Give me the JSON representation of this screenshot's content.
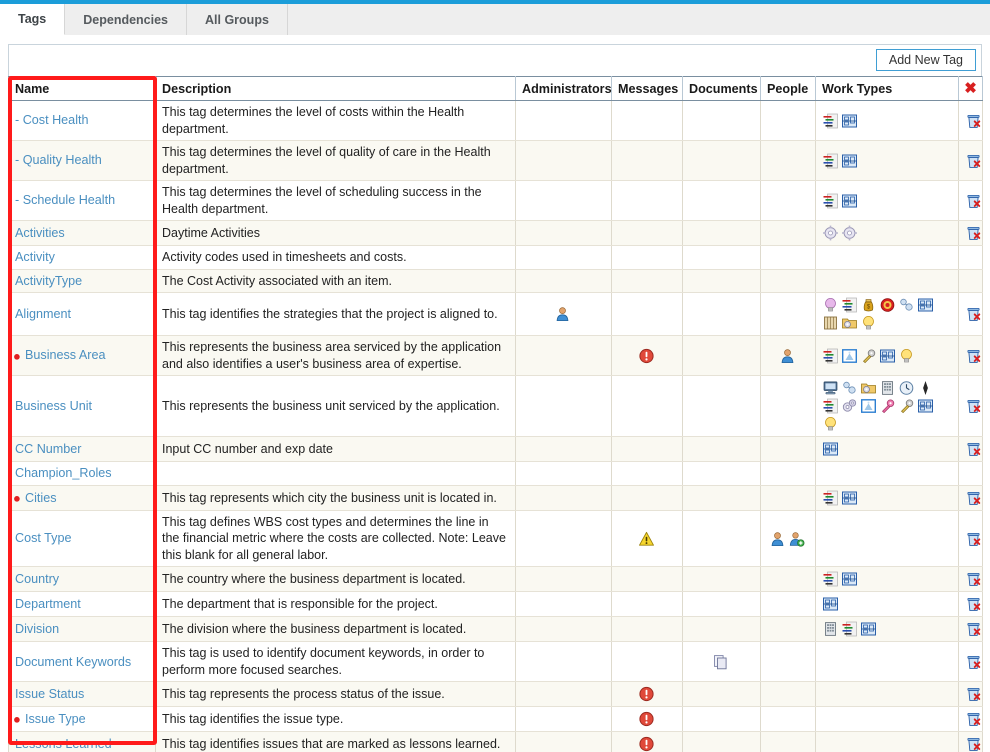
{
  "tabs": [
    {
      "label": "Tags",
      "active": true
    },
    {
      "label": "Dependencies",
      "active": false
    },
    {
      "label": "All Groups",
      "active": false
    }
  ],
  "toolbar": {
    "add_label": "Add New Tag"
  },
  "table": {
    "headers": {
      "name": "Name",
      "description": "Description",
      "administrators": "Administrators",
      "messages": "Messages",
      "documents": "Documents",
      "people": "People",
      "work_types": "Work Types",
      "delete": "delete-all-icon"
    },
    "rows": [
      {
        "name": "- Cost Health",
        "bullet": false,
        "description": "This tag determines the level of costs within the Health department.",
        "administrators": [],
        "messages": [],
        "documents": [],
        "people": [],
        "work_types": [
          "gantt-list-icon",
          "blueprint-icon"
        ],
        "delete": true
      },
      {
        "name": "- Quality Health",
        "bullet": false,
        "description": "This tag determines the level of quality of care in the Health department.",
        "administrators": [],
        "messages": [],
        "documents": [],
        "people": [],
        "work_types": [
          "gantt-list-icon",
          "blueprint-icon"
        ],
        "delete": true
      },
      {
        "name": "- Schedule Health",
        "bullet": false,
        "description": "This tag determines the level of scheduling success in the Health department.",
        "administrators": [],
        "messages": [],
        "documents": [],
        "people": [],
        "work_types": [
          "gantt-list-icon",
          "blueprint-icon"
        ],
        "delete": true
      },
      {
        "name": "Activities",
        "bullet": false,
        "description": "Daytime Activities",
        "administrators": [],
        "messages": [],
        "documents": [],
        "people": [],
        "work_types": [
          "gear-icon",
          "gear-icon"
        ],
        "delete": true
      },
      {
        "name": "Activity",
        "bullet": false,
        "description": "Activity codes used in timesheets and costs.",
        "administrators": [],
        "messages": [],
        "documents": [],
        "people": [],
        "work_types": [],
        "delete": false
      },
      {
        "name": "ActivityType",
        "bullet": false,
        "description": "The Cost Activity associated with an item.",
        "administrators": [],
        "messages": [],
        "documents": [],
        "people": [],
        "work_types": [],
        "delete": false
      },
      {
        "name": "Alignment",
        "bullet": false,
        "description": "This tag identifies the strategies that the project is aligned to.",
        "administrators": [
          "person-icon"
        ],
        "messages": [],
        "documents": [],
        "people": [],
        "work_types": [
          "purple-bulb-icon",
          "gantt-list-icon",
          "money-bag-icon",
          "target-icon",
          "pearls-icon",
          "blueprint-icon",
          "book-icon",
          "gear-folder-icon",
          "yellow-bulb-icon"
        ],
        "delete": true
      },
      {
        "name": "Business Area",
        "bullet": true,
        "description": "This represents the business area serviced by the application and also identifies a user's business area of expertise.",
        "administrators": [],
        "messages": [
          "error-icon"
        ],
        "documents": [],
        "people": [
          "person-icon"
        ],
        "work_types": [
          "gantt-list-icon",
          "framed-picture-icon",
          "key-icon",
          "blueprint-icon",
          "yellow-bulb-icon"
        ],
        "delete": true
      },
      {
        "name": "Business Unit",
        "bullet": false,
        "description": "This represents the business unit serviced by the application.",
        "administrators": [],
        "messages": [],
        "documents": [],
        "people": [],
        "work_types": [
          "monitor-icon",
          "pearls-icon",
          "gear-folder-icon",
          "building-icon",
          "clock-icon",
          "diamond-icon",
          "gantt-list-icon",
          "gears-icon",
          "framed-picture-icon",
          "pink-key-icon",
          "key-icon",
          "blueprint-icon",
          "yellow-bulb-icon"
        ],
        "delete": true
      },
      {
        "name": "CC Number",
        "bullet": false,
        "description": "Input CC number and exp date",
        "administrators": [],
        "messages": [],
        "documents": [],
        "people": [],
        "work_types": [
          "blueprint-icon"
        ],
        "delete": true
      },
      {
        "name": "Champion_Roles",
        "bullet": false,
        "description": "",
        "administrators": [],
        "messages": [],
        "documents": [],
        "people": [],
        "work_types": [],
        "delete": false
      },
      {
        "name": "Cities",
        "bullet": true,
        "description": "This tag represents which city the business unit is located in.",
        "administrators": [],
        "messages": [],
        "documents": [],
        "people": [],
        "work_types": [
          "gantt-list-icon",
          "blueprint-icon"
        ],
        "delete": true
      },
      {
        "name": "Cost Type",
        "bullet": false,
        "description": "This tag defines WBS cost types and determines the line in the financial metric where the costs are collected. Note: Leave this blank for all general labor.",
        "administrators": [],
        "messages": [
          "warning-icon"
        ],
        "documents": [],
        "people": [
          "person-icon",
          "person-add-icon"
        ],
        "work_types": [],
        "delete": true
      },
      {
        "name": "Country",
        "bullet": false,
        "description": "The country where the business department is located.",
        "administrators": [],
        "messages": [],
        "documents": [],
        "people": [],
        "work_types": [
          "gantt-list-icon",
          "blueprint-icon"
        ],
        "delete": true
      },
      {
        "name": "Department",
        "bullet": false,
        "description": "The department that is responsible for the project.",
        "administrators": [],
        "messages": [],
        "documents": [],
        "people": [],
        "work_types": [
          "blueprint-icon"
        ],
        "delete": true
      },
      {
        "name": "Division",
        "bullet": false,
        "description": "The division where the business department is located.",
        "administrators": [],
        "messages": [],
        "documents": [],
        "people": [],
        "work_types": [
          "building-icon",
          "gantt-list-icon",
          "blueprint-icon"
        ],
        "delete": true
      },
      {
        "name": "Document Keywords",
        "bullet": false,
        "description": "This tag is used to identify document keywords, in order to perform more focused searches.",
        "administrators": [],
        "messages": [],
        "documents": [
          "documents-icon"
        ],
        "people": [],
        "work_types": [],
        "delete": true
      },
      {
        "name": "Issue Status",
        "bullet": false,
        "description": "This tag represents the process status of the issue.",
        "administrators": [],
        "messages": [
          "error-icon"
        ],
        "documents": [],
        "people": [],
        "work_types": [],
        "delete": true
      },
      {
        "name": "Issue Type",
        "bullet": true,
        "description": "This tag identifies the issue type.",
        "administrators": [],
        "messages": [
          "error-icon"
        ],
        "documents": [],
        "people": [],
        "work_types": [],
        "delete": true
      },
      {
        "name": "Lessons Learned",
        "bullet": false,
        "description": "This tag identifies issues that are marked as lessons learned.",
        "administrators": [],
        "messages": [
          "error-icon"
        ],
        "documents": [],
        "people": [],
        "work_types": [],
        "delete": true
      }
    ]
  },
  "annotation": {
    "highlight_color": "#ff1a1a",
    "highlighted_column": "Name"
  },
  "colors": {
    "accent_blue": "#1b9dd9",
    "link_blue": "#4a8fc0",
    "delete_red": "#d81f1f",
    "bullet_red": "#e02020"
  }
}
